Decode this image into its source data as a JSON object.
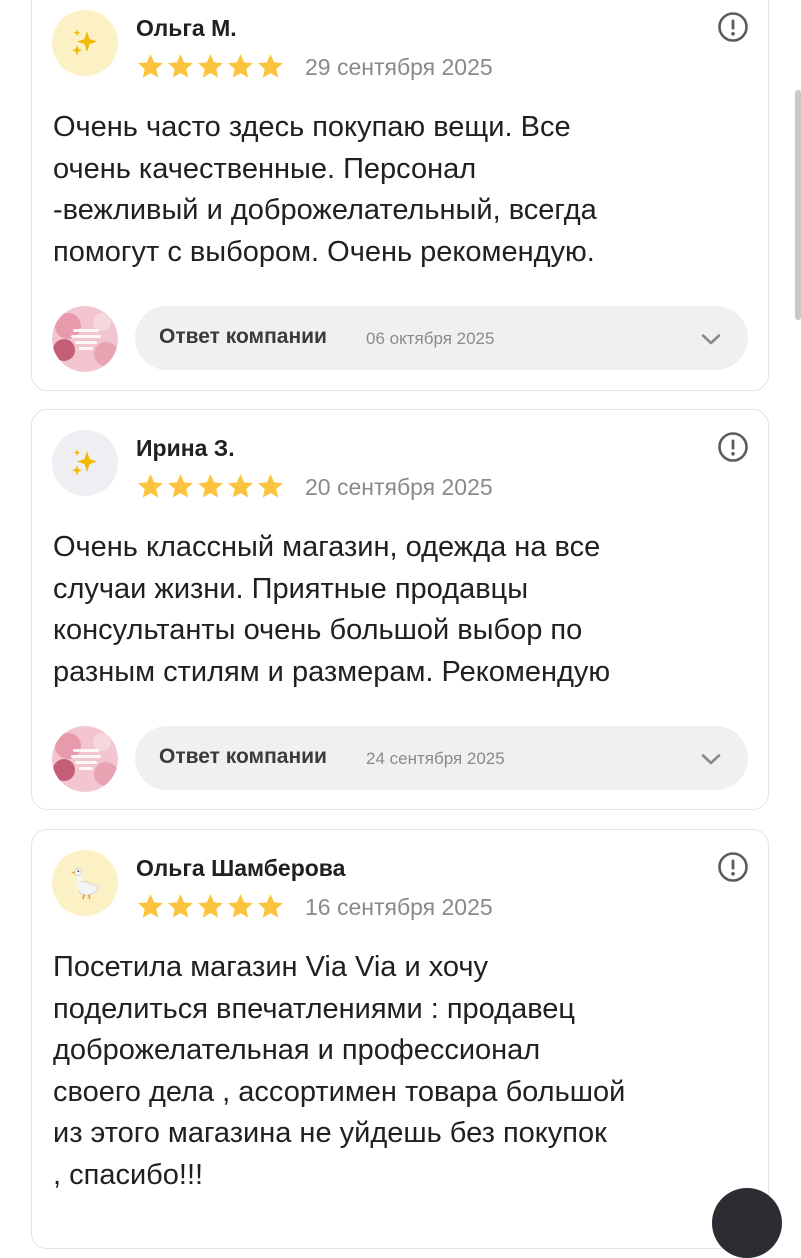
{
  "reviews": [
    {
      "author": "Ольга М.",
      "rating": 5,
      "date": "29 сентября 2025",
      "avatar_icon": "sparkles-icon",
      "text": "Очень часто здесь покупаю вещи. Все\nочень качественные. Персонал\n-вежливый и доброжелательный, всегда\nпомогут с выбором. Очень рекомендую.",
      "reply": {
        "title": "Ответ компании",
        "date": "06 октября 2025"
      }
    },
    {
      "author": "Ирина З.",
      "rating": 5,
      "date": "20 сентября 2025",
      "avatar_icon": "sparkles-icon",
      "text": "Очень классный магазин, одежда на все\nслучаи жизни. Приятные продавцы\nконсультанты очень большой выбор по\nразным стилям и размерам. Рекомендую",
      "reply": {
        "title": "Ответ компании",
        "date": "24 сентября 2025"
      }
    },
    {
      "author": "Ольга Шамберова",
      "rating": 5,
      "date": "16 сентября 2025",
      "avatar_icon": "goose-icon",
      "text": "Посетила магазин Via Via и хочу\nподелиться впечатлениями : продавец\nдоброжелательная и профессионал\nсвоего дела , ассортимен товара большой\nиз этого магазина не уйдешь без покупок\n, спасибо!!!"
    }
  ],
  "colors": {
    "star": "#fcc43e",
    "muted_text": "#8a8a8a",
    "reply_bg": "#f0f0f2",
    "card_border": "#e4e4e4",
    "avatar_yellow": "#fbf1c4",
    "avatar_grey": "#eeeef3"
  }
}
